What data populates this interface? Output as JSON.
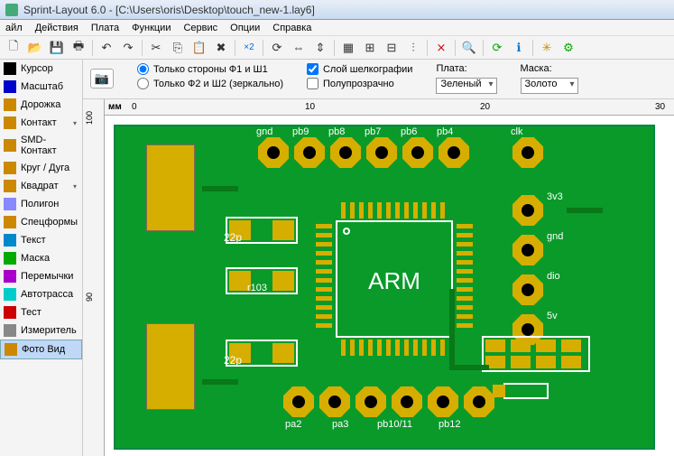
{
  "title": "Sprint-Layout 6.0 - [C:\\Users\\oris\\Desktop\\touch_new-1.lay6]",
  "menu": [
    "айл",
    "Действия",
    "Плата",
    "Функции",
    "Сервис",
    "Опции",
    "Справка"
  ],
  "sidebar": {
    "items": [
      {
        "label": "Курсор",
        "icon": "#000"
      },
      {
        "label": "Масштаб",
        "icon": "#00c"
      },
      {
        "label": "Дорожка",
        "icon": "#c80"
      },
      {
        "label": "Контакт",
        "icon": "#c80",
        "dd": true
      },
      {
        "label": "SMD-Контакт",
        "icon": "#c80"
      },
      {
        "label": "Круг / Дуга",
        "icon": "#c80"
      },
      {
        "label": "Квадрат",
        "icon": "#c80",
        "dd": true
      },
      {
        "label": "Полигон",
        "icon": "#88f"
      },
      {
        "label": "Спецформы",
        "icon": "#c80"
      },
      {
        "label": "Текст",
        "icon": "#08c"
      },
      {
        "label": "Маска",
        "icon": "#0a0"
      },
      {
        "label": "Перемычки",
        "icon": "#a0c"
      },
      {
        "label": "Автотрасса",
        "icon": "#0cc"
      },
      {
        "label": "Тест",
        "icon": "#c00"
      },
      {
        "label": "Измеритель",
        "icon": "#888"
      },
      {
        "label": "Фото Вид",
        "icon": "#c80",
        "hl": true
      }
    ]
  },
  "opts": {
    "radio1": "Только стороны Ф1 и Ш1",
    "radio2": "Только Ф2 и Ш2 (зеркально)",
    "chk1": "Слой шелкографии",
    "chk2": "Полупрозрачно",
    "plata_label": "Плата:",
    "plata_val": "Зеленый",
    "maska_label": "Маска:",
    "maska_val": "Золото"
  },
  "ruler": {
    "mm": "мм",
    "h": [
      "0",
      "10",
      "20",
      "30"
    ],
    "v": [
      "100",
      "90"
    ]
  },
  "silk": {
    "top": [
      "gnd",
      "pb9",
      "pb8",
      "pb7",
      "pb6",
      "pb4",
      "clk"
    ],
    "right": [
      "3v3",
      "gnd",
      "dio",
      "5v"
    ],
    "bot": [
      "pa2",
      "pa3",
      "pb10/11",
      "pb12"
    ],
    "c": [
      "22p",
      "22p",
      "r103"
    ],
    "chip": "ARM"
  }
}
